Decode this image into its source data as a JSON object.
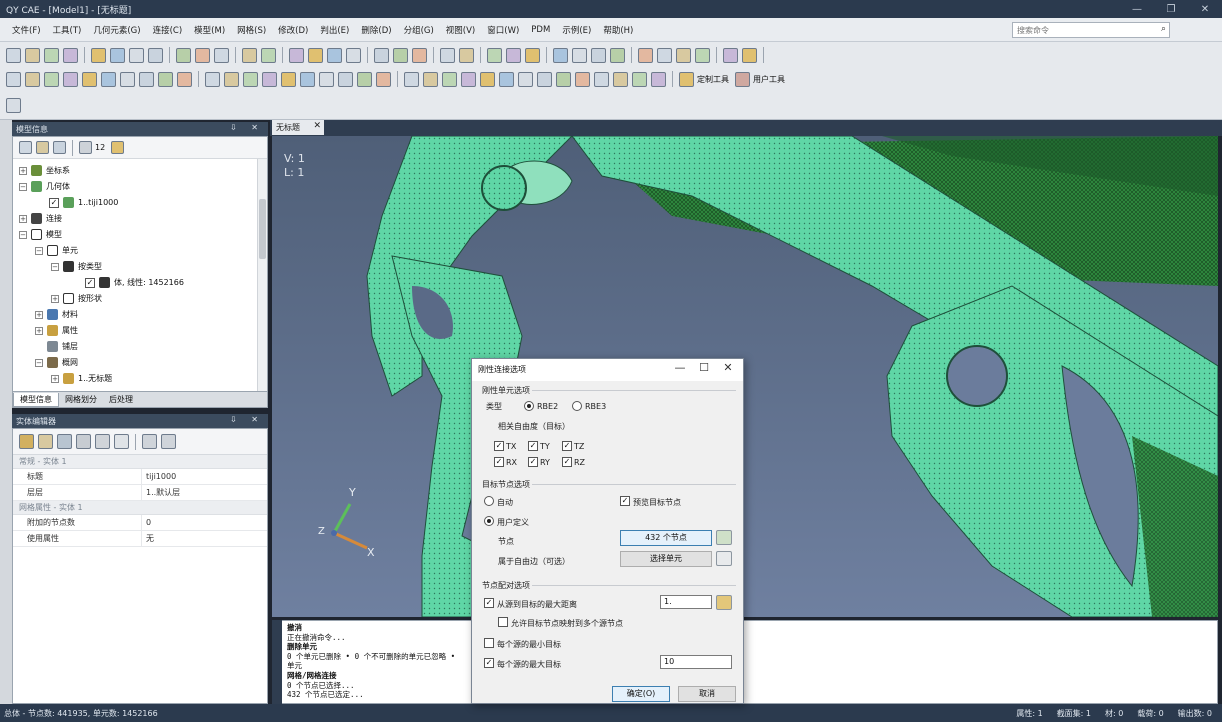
{
  "window": {
    "title": "QY CAE - [Model1] - [无标题]",
    "controls": [
      "—",
      "❐",
      "✕"
    ]
  },
  "menu": {
    "items": [
      "文件(F)",
      "工具(T)",
      "几何元素(G)",
      "连接(C)",
      "模型(M)",
      "网格(S)",
      "修改(D)",
      "判出(E)",
      "删除(D)",
      "分组(G)",
      "视图(V)",
      "窗口(W)",
      "PDM",
      "示例(E)",
      "帮助(H)"
    ],
    "search_placeholder": "搜索命令",
    "search_icon": "search-icon"
  },
  "toolbar": {
    "custom_tools_label": "定制工具",
    "user_tools_label": "用户工具"
  },
  "model_panel": {
    "title": "模型信息",
    "toolbar_count": "12",
    "items": [
      {
        "label": "坐标系"
      },
      {
        "label": "几何体"
      },
      {
        "label": "1..tiji1000"
      },
      {
        "label": "连接"
      },
      {
        "label": "模型"
      },
      {
        "label": "单元"
      },
      {
        "label": "按类型"
      },
      {
        "label": "体, 线性: 1452166"
      },
      {
        "label": "按形状"
      },
      {
        "label": "材料"
      },
      {
        "label": "属性"
      },
      {
        "label": "铺层"
      },
      {
        "label": "概网"
      },
      {
        "label": "1..无标题"
      }
    ],
    "tabs": [
      "模型信息",
      "网格划分",
      "后处理"
    ]
  },
  "entity_editor": {
    "title": "实体编辑器",
    "groups": [
      {
        "name": "常规 - 实体 1",
        "rows": [
          {
            "key": "标题",
            "value": "tiji1000"
          },
          {
            "key": "层层",
            "value": "1..默认层"
          }
        ]
      },
      {
        "name": "网格属性 - 实体 1",
        "rows": [
          {
            "key": "附加的节点数",
            "value": "0"
          },
          {
            "key": "使用属性",
            "value": "无"
          }
        ]
      }
    ]
  },
  "viewport": {
    "tab_label": "无标题",
    "info_v": "V: 1",
    "info_l": "L: 1",
    "axis_x": "X",
    "axis_y": "Y",
    "axis_z": "Z"
  },
  "output": {
    "lines": [
      "撤消",
      "正在撤消命令...",
      "删除单元",
      "0 个单元已删除 • 0 个不可删除的单元已忽略 •",
      "单元",
      "网格/网格连接",
      "0 个节点已选择...",
      "432 个节点已选定..."
    ]
  },
  "status": {
    "left": "总体 - 节点数: 441935, 单元数: 1452166",
    "right": [
      "属性: 1",
      "截面集: 1",
      "材: 0",
      "载荷: 0",
      "输出数: 0"
    ]
  },
  "dialog": {
    "title": "刚性连接选项",
    "section_element": "刚性单元选项",
    "type_label": "类型",
    "type_options": [
      "RBE2",
      "RBE3"
    ],
    "type_selected": "RBE2",
    "dof_label": "相关自由度（目标）",
    "dofs": [
      "TX",
      "TY",
      "TZ",
      "RX",
      "RY",
      "RZ"
    ],
    "section_target": "目标节点选项",
    "mode_auto": "自动",
    "mode_user": "用户定义",
    "mode_selected": "用户定义",
    "preview_label": "预览目标节点",
    "nodes_label": "节点",
    "nodes_value": "432 个节点",
    "free_label": "属于自由边（可选）",
    "select_element": "选择单元",
    "section_pair": "节点配对选项",
    "max_dist_label": "从源到目标的最大距离",
    "max_dist_value": "1.",
    "allow_label": "允许目标节点映射到多个源节点",
    "min_target_label": "每个源的最小目标",
    "max_target_label": "每个源的最大目标",
    "max_target_value": "10",
    "ok": "确定(O)",
    "cancel": "取消"
  }
}
